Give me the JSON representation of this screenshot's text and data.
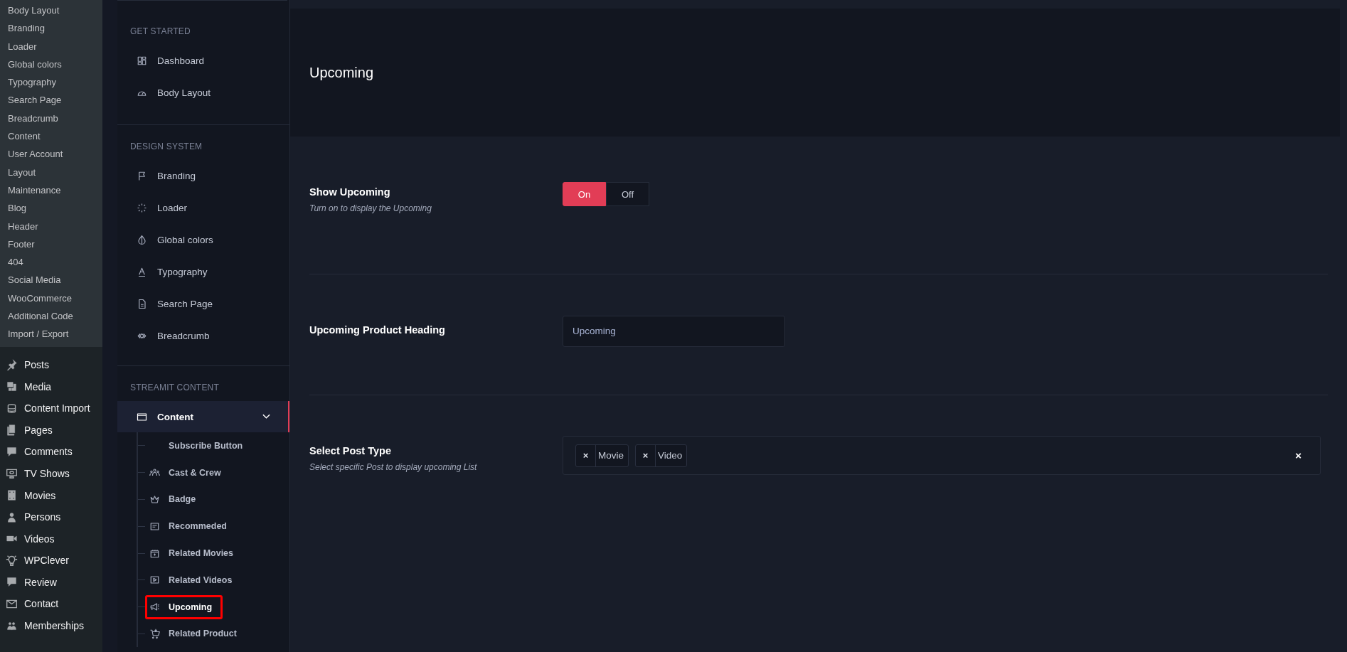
{
  "wp_submenu": [
    "Body Layout",
    "Branding",
    "Loader",
    "Global colors",
    "Typography",
    "Search Page",
    "Breadcrumb",
    "Content",
    "User Account",
    "Layout",
    "Maintenance",
    "Blog",
    "Header",
    "Footer",
    "404",
    "Social Media",
    "WooCommerce",
    "Additional Code",
    "Import / Export"
  ],
  "wp_menu": [
    {
      "label": "Posts"
    },
    {
      "label": "Media"
    },
    {
      "label": "Content Import"
    },
    {
      "label": "Pages"
    },
    {
      "label": "Comments"
    },
    {
      "label": "TV Shows"
    },
    {
      "label": "Movies"
    },
    {
      "label": "Persons"
    },
    {
      "label": "Videos"
    },
    {
      "label": "WPClever"
    },
    {
      "label": "Review"
    },
    {
      "label": "Contact"
    },
    {
      "label": "Memberships"
    }
  ],
  "options_sidebar": {
    "sections": [
      {
        "heading": "GET STARTED",
        "items": [
          {
            "label": "Dashboard",
            "selected": false
          },
          {
            "label": "Body Layout",
            "selected": false
          }
        ]
      },
      {
        "heading": "DESIGN SYSTEM",
        "items": [
          {
            "label": "Branding",
            "selected": false
          },
          {
            "label": "Loader",
            "selected": false
          },
          {
            "label": "Global colors",
            "selected": false
          },
          {
            "label": "Typography",
            "selected": false
          },
          {
            "label": "Search Page",
            "selected": false
          },
          {
            "label": "Breadcrumb",
            "selected": false
          }
        ]
      },
      {
        "heading": "STREAMIT CONTENT",
        "items": [
          {
            "label": "Content",
            "selected": true,
            "expanded": true,
            "children": [
              {
                "label": "Subscribe Button",
                "selected": false,
                "highlighted": false
              },
              {
                "label": "Cast & Crew",
                "selected": false,
                "highlighted": false
              },
              {
                "label": "Badge",
                "selected": false,
                "highlighted": false
              },
              {
                "label": "Recommeded",
                "selected": false,
                "highlighted": false
              },
              {
                "label": "Related Movies",
                "selected": false,
                "highlighted": false
              },
              {
                "label": "Related Videos",
                "selected": false,
                "highlighted": false
              },
              {
                "label": "Upcoming",
                "selected": true,
                "highlighted": true
              },
              {
                "label": "Related Product",
                "selected": false,
                "highlighted": false
              }
            ]
          }
        ]
      }
    ]
  },
  "page": {
    "title": "Upcoming",
    "settings": [
      {
        "kind": "toggle",
        "label": "Show Upcoming",
        "description": "Turn on to display the Upcoming",
        "options": [
          {
            "label": "On",
            "selected": true
          },
          {
            "label": "Off",
            "selected": false
          }
        ]
      },
      {
        "kind": "text",
        "label": "Upcoming Product Heading",
        "value": "Upcoming"
      },
      {
        "kind": "multiselect",
        "label": "Select Post Type",
        "description": "Select specific Post to display upcoming List",
        "tags": [
          {
            "label": "Movie",
            "remove": "×"
          },
          {
            "label": "Video",
            "remove": "×"
          }
        ],
        "clear": "×"
      }
    ]
  }
}
